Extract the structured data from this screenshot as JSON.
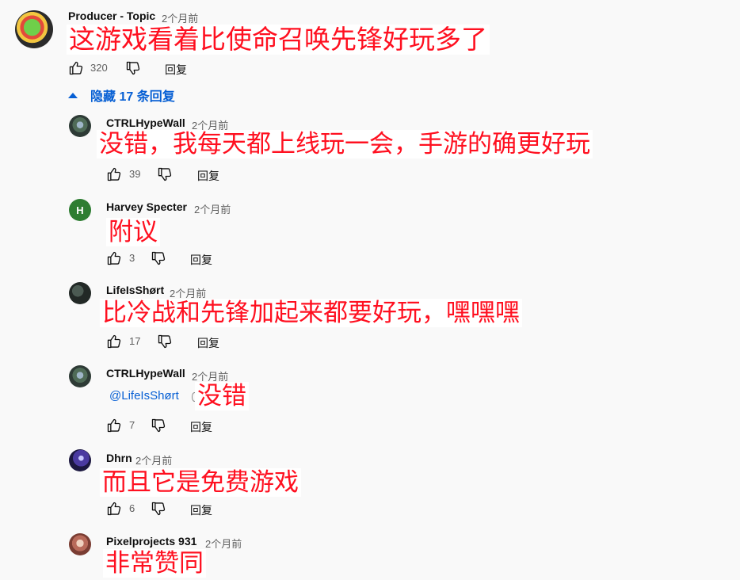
{
  "main_comment": {
    "author": "Producer - Topic",
    "time": "2个月前",
    "text": "这游戏看着比使命召唤先锋好玩多了",
    "likes": "320",
    "reply_label": "回复"
  },
  "replies_toggle": {
    "label": "隐藏 17 条回复"
  },
  "replies": [
    {
      "author": "CTRLHypeWall",
      "time": "2个月前",
      "text": "没错，我每天都上线玩一会，手游的确更好玩",
      "likes": "39",
      "reply_label": "回复"
    },
    {
      "author": "Harvey Specter",
      "time": "2个月前",
      "avatar_letter": "H",
      "text": "附议",
      "likes": "3",
      "reply_label": "回复"
    },
    {
      "author": "LifeIsShørt",
      "time": "2个月前",
      "text": "比冷战和先锋加起来都要好玩，嘿嘿嘿",
      "likes": "17",
      "reply_label": "回复"
    },
    {
      "author": "CTRLHypeWall",
      "time": "2个月前",
      "mention": "@LifeIsShørt",
      "text": "没错",
      "likes": "7",
      "reply_label": "回复"
    },
    {
      "author": "Dhrn",
      "time": "2个月前",
      "text": "而且它是免费游戏",
      "likes": "6",
      "reply_label": "回复"
    },
    {
      "author": "Pixelprojects 931",
      "time": "2个月前",
      "text": "非常赞同"
    }
  ],
  "colors": {
    "overlay_text": "#ff1020",
    "link": "#065fd4",
    "muted": "#606060"
  },
  "icons": [
    "thumb-up-icon",
    "thumb-down-icon",
    "caret-up-icon"
  ]
}
